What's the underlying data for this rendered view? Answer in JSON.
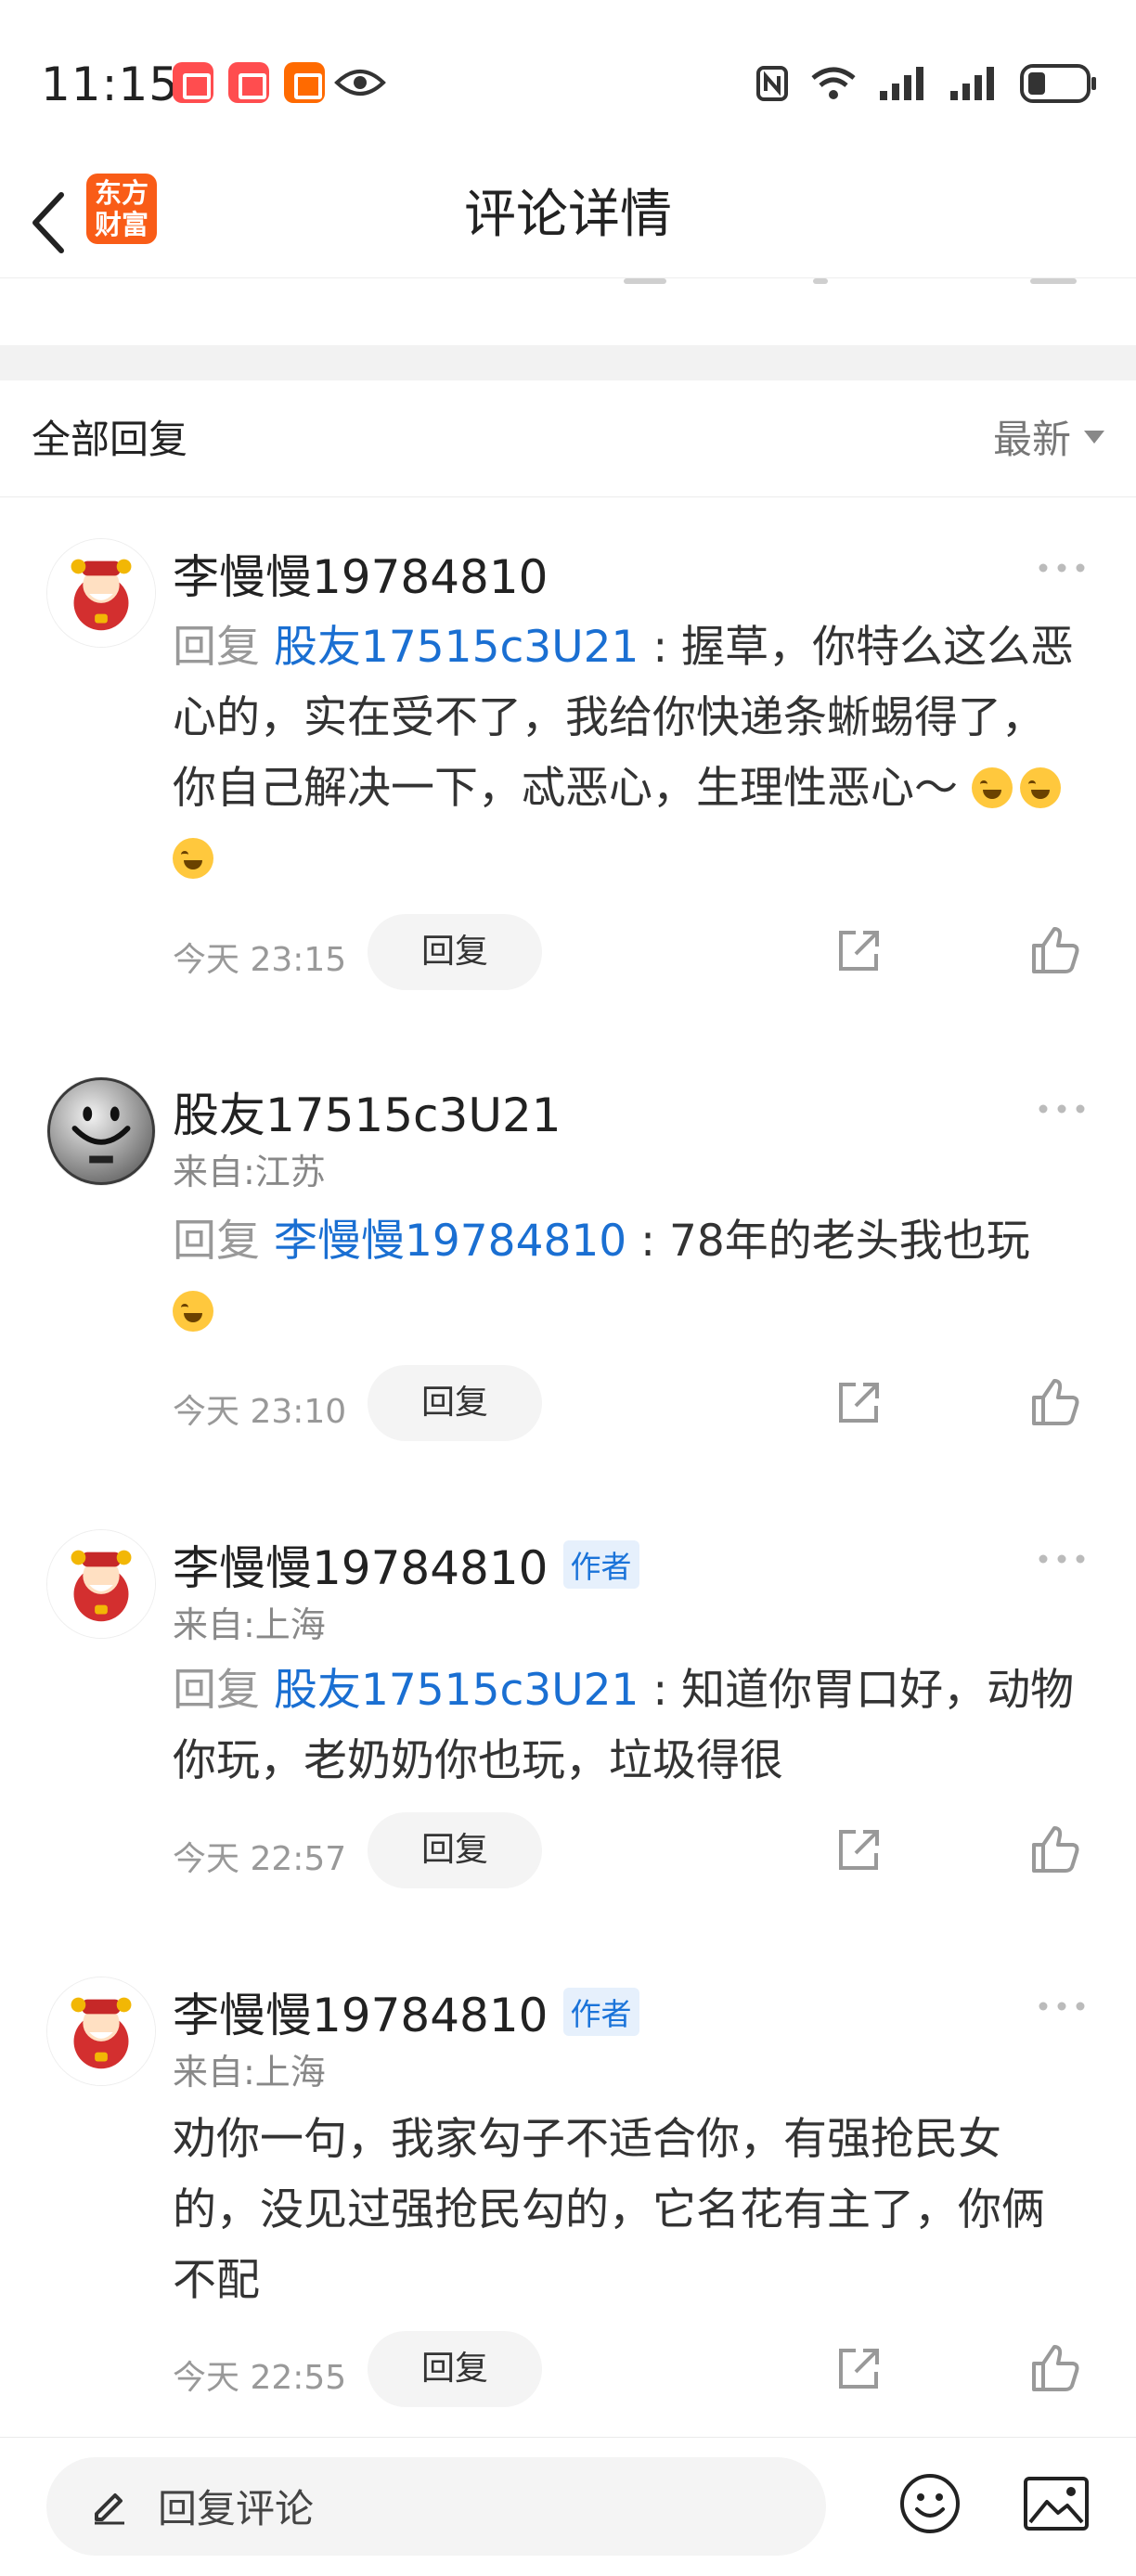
{
  "status_bar": {
    "time": "11:15"
  },
  "header": {
    "title": "评论详情",
    "logo_text": "东方财富"
  },
  "section": {
    "title": "全部回复",
    "sort_label": "最新"
  },
  "comments": [
    {
      "user": "李慢慢19784810",
      "is_author": false,
      "location": "",
      "reply_prefix": "回复",
      "reply_to": "股友17515c3U21",
      "separator": ":",
      "text": "握草，你特么这么恶心的，实在受不了，我给你快递条蜥蜴得了，你自己解决一下，忒恶心，生理性恶心～",
      "emojis": [
        "laughing-crying-emoji",
        "laughing-crying-emoji",
        "laughing-crying-emoji"
      ],
      "time": "今天 23:15",
      "reply_button": "回复"
    },
    {
      "user": "股友17515c3U21",
      "is_author": false,
      "location": "来自:江苏",
      "reply_prefix": "回复",
      "reply_to": "李慢慢19784810",
      "separator": ":",
      "text": "78年的老头我也玩",
      "emojis": [
        "giggle-emoji"
      ],
      "time": "今天 23:10",
      "reply_button": "回复"
    },
    {
      "user": "李慢慢19784810",
      "is_author": true,
      "author_label": "作者",
      "location": "来自:上海",
      "reply_prefix": "回复",
      "reply_to": "股友17515c3U21",
      "separator": ":",
      "text": "知道你胃口好，动物你玩，老奶奶你也玩，垃圾得很",
      "time": "今天 22:57",
      "reply_button": "回复"
    },
    {
      "user": "李慢慢19784810",
      "is_author": true,
      "author_label": "作者",
      "location": "来自:上海",
      "text": "劝你一句，我家勾子不适合你，有强抢民女的，没见过强抢民勾的，它名花有主了，你俩不配",
      "time": "今天 22:55",
      "reply_button": "回复"
    }
  ],
  "bottom_bar": {
    "reply_placeholder": "回复评论"
  },
  "colors": {
    "brand": "#f95c17",
    "mention": "#1a6fd2",
    "author_badge": "#1a73d9"
  }
}
